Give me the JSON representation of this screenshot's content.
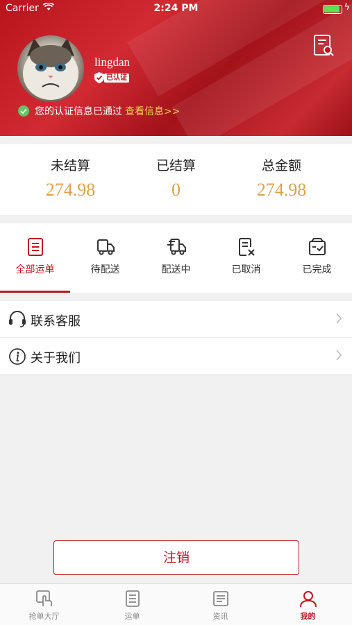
{
  "status_bar": {
    "carrier": "Carrier",
    "time": "2:24 PM"
  },
  "profile": {
    "username": "lingdan",
    "verified_badge": "已认证",
    "notice_text": "您的认证信息已通过",
    "notice_link": "查看信息>>"
  },
  "stats": [
    {
      "label": "未结算",
      "value": "274.98"
    },
    {
      "label": "已结算",
      "value": "0"
    },
    {
      "label": "总金额",
      "value": "274.98"
    }
  ],
  "order_tabs": [
    {
      "label": "全部运单",
      "icon": "document-list-icon",
      "active": true
    },
    {
      "label": "待配送",
      "icon": "truck-icon",
      "active": false
    },
    {
      "label": "配送中",
      "icon": "delivery-truck-icon",
      "active": false
    },
    {
      "label": "已取消",
      "icon": "document-cancel-icon",
      "active": false
    },
    {
      "label": "已完成",
      "icon": "box-check-icon",
      "active": false
    }
  ],
  "menu": [
    {
      "label": "联系客服",
      "icon": "headset-icon"
    },
    {
      "label": "关于我们",
      "icon": "info-icon"
    }
  ],
  "logout_label": "注销",
  "tab_bar": [
    {
      "label": "抢单大厅",
      "icon": "hand-tap-icon",
      "active": false
    },
    {
      "label": "运单",
      "icon": "document-icon",
      "active": false
    },
    {
      "label": "资讯",
      "icon": "news-icon",
      "active": false
    },
    {
      "label": "我的",
      "icon": "user-icon",
      "active": true
    }
  ],
  "colors": {
    "accent": "#c0121b",
    "amount": "#e0a04a",
    "link": "#f4cf5a"
  }
}
